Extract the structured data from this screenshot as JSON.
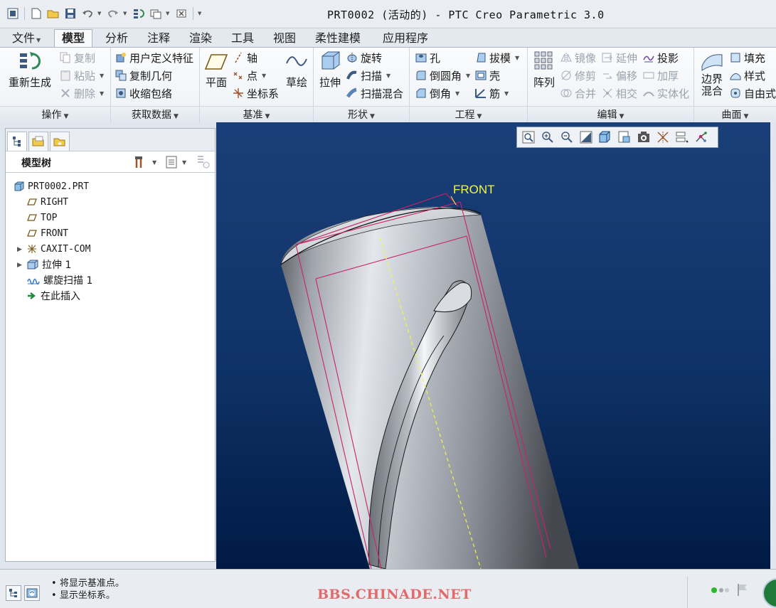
{
  "titlebar": {
    "title": "PRT0002 (活动的) - PTC Creo Parametric 3.0"
  },
  "tabs": [
    {
      "label": "文件",
      "has_dropdown": true
    },
    {
      "label": "模型",
      "active": true
    },
    {
      "label": "分析"
    },
    {
      "label": "注释"
    },
    {
      "label": "渲染"
    },
    {
      "label": "工具"
    },
    {
      "label": "视图"
    },
    {
      "label": "柔性建模"
    },
    {
      "label": "应用程序"
    }
  ],
  "ribbon": {
    "operations": {
      "footer": "操作",
      "regenerate": "重新生成",
      "copy": "复制",
      "paste": "粘贴",
      "delete": "删除"
    },
    "get_data": {
      "footer": "获取数据",
      "udf": "用户定义特征",
      "copy_geom": "复制几何",
      "shrinkwrap": "收缩包络"
    },
    "datum": {
      "footer": "基准",
      "plane": "平面",
      "axis": "轴",
      "point": "点",
      "csys": "坐标系",
      "sketch": "草绘"
    },
    "shapes": {
      "footer": "形状",
      "extrude": "拉伸",
      "revolve": "旋转",
      "sweep": "扫描",
      "swept_blend": "扫描混合"
    },
    "engineering": {
      "footer": "工程",
      "hole": "孔",
      "round": "倒圆角",
      "chamfer": "倒角",
      "draft": "拔模",
      "shell": "壳",
      "rib": "筋"
    },
    "editing": {
      "footer": "编辑",
      "pattern": "阵列",
      "mirror": "镜像",
      "trim": "修剪",
      "merge": "合并",
      "extend": "延伸",
      "offset": "偏移",
      "intersect": "相交",
      "project": "投影",
      "thicken": "加厚",
      "solidify": "实体化"
    },
    "surfaces": {
      "footer": "曲面",
      "boundary_blend": "边界\n混合",
      "boundary_blend_l1": "边界",
      "boundary_blend_l2": "混合",
      "fill": "填充",
      "style": "样式",
      "freestyle": "自由式"
    }
  },
  "model_tree": {
    "title": "模型树",
    "items": [
      {
        "label": "PRT0002.PRT",
        "icon": "part-icon"
      },
      {
        "label": "RIGHT",
        "icon": "datum-plane-icon"
      },
      {
        "label": "TOP",
        "icon": "datum-plane-icon"
      },
      {
        "label": "FRONT",
        "icon": "datum-plane-icon"
      },
      {
        "label": "CAXIT-COM",
        "icon": "csys-icon"
      },
      {
        "label": "拉伸 1",
        "icon": "extrude-icon",
        "expandable": true
      },
      {
        "label": "螺旋扫描 1",
        "icon": "helical-sweep-icon",
        "expandable": true
      },
      {
        "label": "在此插入",
        "icon": "insert-here-arrow-icon"
      }
    ]
  },
  "viewport": {
    "plane_label": "FRONT"
  },
  "status": {
    "messages": [
      "将显示基准点。",
      "显示坐标系。"
    ],
    "watermark": "BBS.CHINADE.NET"
  },
  "colors": {
    "viewport_top": "#1a3f78",
    "viewport_bottom": "#001a44",
    "datum_plane": "#c8236a",
    "axis_line": "#f5f542",
    "plane_label": "#f5f542",
    "watermark": "#e26a6a"
  }
}
